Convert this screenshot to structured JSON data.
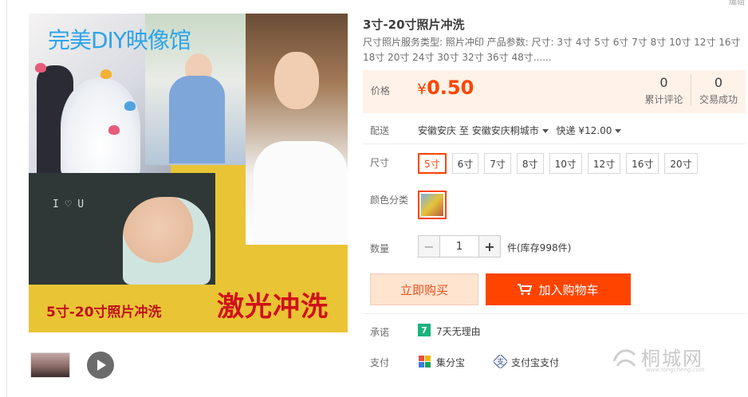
{
  "top_corner": "编辑",
  "image": {
    "title_overlay": "完美DIY映像馆",
    "bottom_left_overlay": "5寸-20寸照片冲洗",
    "bottom_right_overlay": "激光冲洗",
    "board_text": "I ♡ U"
  },
  "product": {
    "title": "3寸-20寸照片冲洗",
    "description": "尺寸照片服务类型: 照片冲印 产品参数:  尺寸: 3寸 4寸 5寸 6寸 7寸 8寸 10寸 12寸 16寸 18寸 20寸 24寸 30寸 32寸 36寸 48寸......"
  },
  "price": {
    "label": "价格",
    "symbol": "¥",
    "value": "0.50",
    "stats": [
      {
        "value": "0",
        "label": "累计评论"
      },
      {
        "value": "0",
        "label": "交易成功"
      }
    ]
  },
  "shipping": {
    "label": "配送",
    "from": "安徽安庆",
    "to_word": "至",
    "to": "安徽安庆桐城市",
    "method": "快递 ¥12.00"
  },
  "sizes": {
    "label": "尺寸",
    "options": [
      "5寸",
      "6寸",
      "7寸",
      "8寸",
      "10寸",
      "12寸",
      "16寸",
      "20寸"
    ],
    "selected_index": 0
  },
  "color": {
    "label": "颜色分类"
  },
  "quantity": {
    "label": "数量",
    "value": "1",
    "minus": "−",
    "plus": "+",
    "stock": "件(库存998件)"
  },
  "actions": {
    "buy_now": "立即购买",
    "add_cart": "加入购物车"
  },
  "promise": {
    "label": "承诺",
    "badge": "7",
    "text": "7天无理由"
  },
  "payment": {
    "label": "支付",
    "methods": [
      "集分宝",
      "支付宝支付"
    ]
  },
  "watermark": {
    "main": "桐城网",
    "sub": "www.tongcheng.com"
  },
  "colors": {
    "accent": "#ff4400",
    "price_bg": "#fff2e8",
    "buy_now_bg": "#ffe4d0",
    "promise_green": "#19b37e"
  }
}
